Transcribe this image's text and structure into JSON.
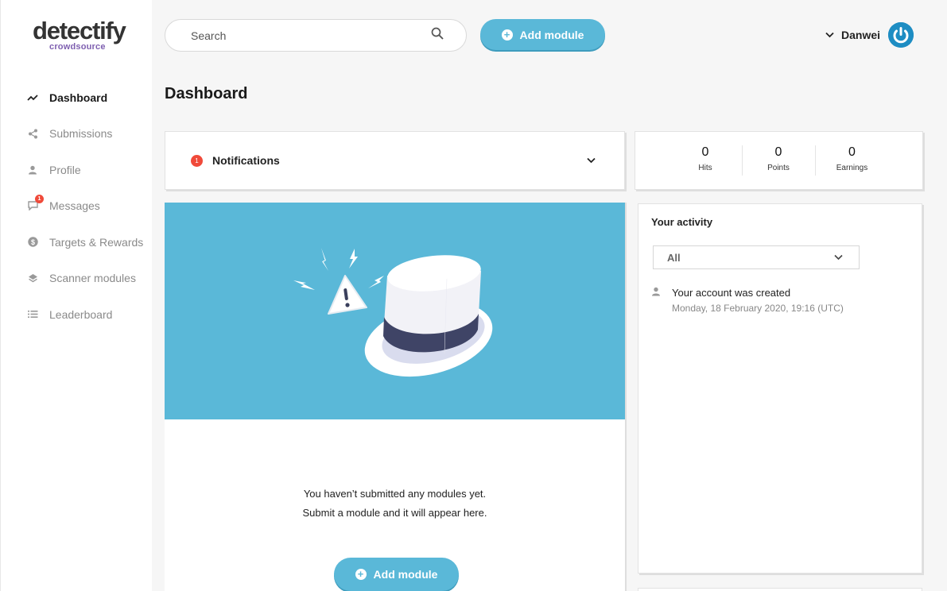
{
  "brand": {
    "name": "detectify",
    "sub": "crowdsource"
  },
  "sidebar": {
    "items": [
      {
        "label": "Dashboard",
        "icon": "trend-icon",
        "active": true
      },
      {
        "label": "Submissions",
        "icon": "share-icon"
      },
      {
        "label": "Profile",
        "icon": "person-icon"
      },
      {
        "label": "Messages",
        "icon": "chat-icon",
        "badge": "1"
      },
      {
        "label": "Targets & Rewards",
        "icon": "dollar-icon"
      },
      {
        "label": "Scanner modules",
        "icon": "layers-icon"
      },
      {
        "label": "Leaderboard",
        "icon": "list-icon"
      }
    ]
  },
  "search": {
    "placeholder": "Search"
  },
  "header": {
    "add_module_label": "Add module",
    "user_name": "Danwei"
  },
  "page": {
    "title": "Dashboard"
  },
  "notifications": {
    "label": "Notifications",
    "count": "1"
  },
  "stats": [
    {
      "value": "0",
      "label": "Hits"
    },
    {
      "value": "0",
      "label": "Points"
    },
    {
      "value": "0",
      "label": "Earnings"
    }
  ],
  "empty_state": {
    "line1": "You haven’t submitted any modules yet.",
    "line2": "Submit a module and it will appear here.",
    "button_label": "Add module"
  },
  "activity": {
    "title": "Your activity",
    "filter": "All",
    "items": [
      {
        "title": "Your account was created",
        "time": "Monday, 18 February 2020, 19:16 (UTC)"
      }
    ]
  },
  "colors": {
    "accent": "#5ab8d8",
    "badge": "#f04a3a",
    "brand_sub": "#7e5fb0",
    "avatar": "#1e8dc3"
  }
}
